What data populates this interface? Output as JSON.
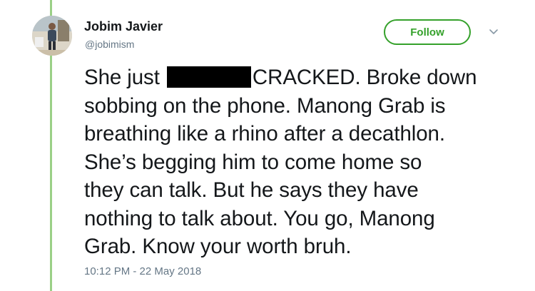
{
  "author": {
    "display_name": "Jobim Javier",
    "handle": "@jobimism"
  },
  "actions": {
    "follow_label": "Follow",
    "menu_icon": "chevron-down-icon"
  },
  "tweet": {
    "lines": [
      {
        "before": "She just",
        "after": "CRACKED. Broke down"
      },
      "sobbing on the phone. Manong Grab is",
      "breathing like a rhino after a decathlon.",
      "She’s begging him to come home so",
      "they can talk. But he says they have",
      "nothing to talk about. You go, Manong",
      "Grab. Know your worth bruh."
    ],
    "timestamp": "10:12 PM - 22 May 2018"
  },
  "colors": {
    "accent": "#35a12b",
    "thread_line": "#9bd087",
    "text_primary": "#14171a",
    "text_secondary": "#657786",
    "redaction": "#000000"
  }
}
